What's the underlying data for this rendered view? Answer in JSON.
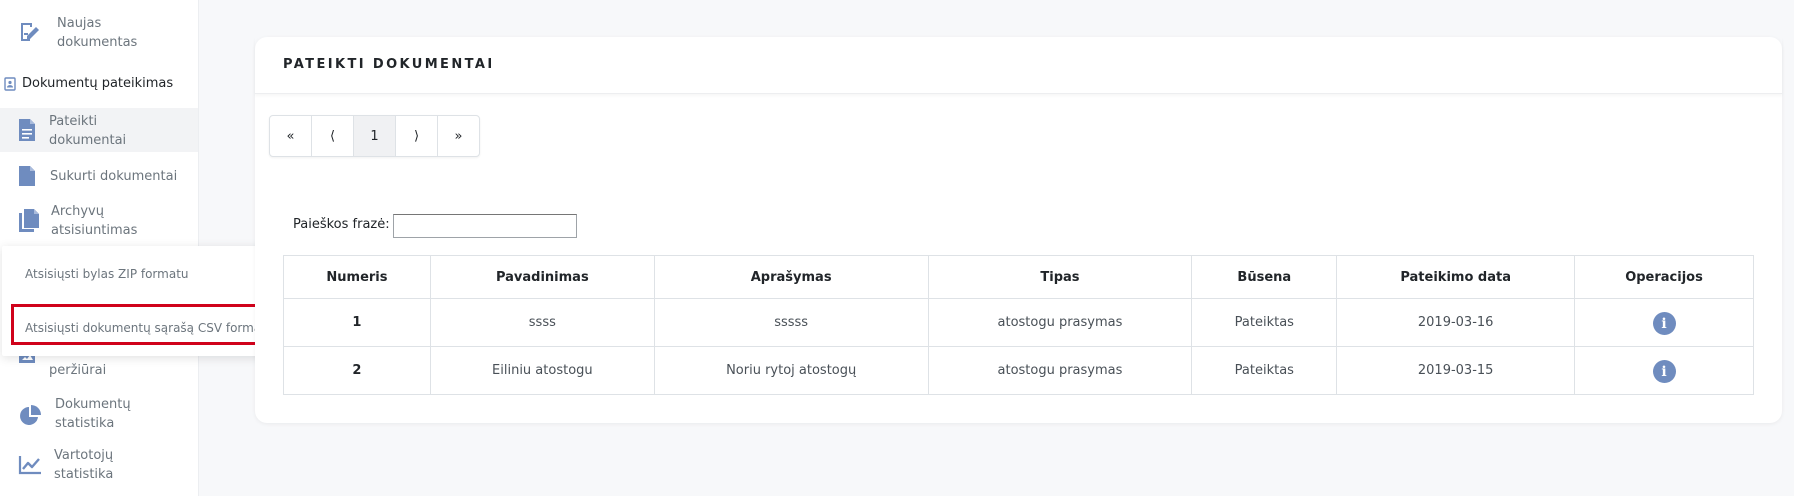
{
  "sidebar": {
    "items": [
      {
        "label": "Naujas dokumentas",
        "icon": "edit-document-icon"
      },
      {
        "label": "Dokumentų pateikimas",
        "icon": "contact-card-icon"
      },
      {
        "label": "Pateikti dokumentai",
        "icon": "document-icon"
      },
      {
        "label": "Sukurti dokumentai",
        "icon": "document-icon"
      },
      {
        "label": "Archyvų atsisiuntimas",
        "icon": "copy-documents-icon"
      },
      {
        "label": "peržiūrai",
        "icon": "image-document-icon"
      },
      {
        "label": "Dokumentų statistika",
        "icon": "pie-chart-icon"
      },
      {
        "label": "Vartotojų statistika",
        "icon": "line-chart-icon"
      }
    ]
  },
  "popup": {
    "zip": "Atsisiųsti bylas ZIP formatu",
    "csv": "Atsisiųsti dokumentų sąrašą CSV formatu"
  },
  "card": {
    "title": "PATEIKTI DOKUMENTAI"
  },
  "pager": {
    "first": "«",
    "prev": "⟨",
    "current": "1",
    "next": "⟩",
    "last": "»"
  },
  "search": {
    "label": "Paieškos frazė:",
    "value": ""
  },
  "table": {
    "headers": [
      "Numeris",
      "Pavadinimas",
      "Aprašymas",
      "Tipas",
      "Būsena",
      "Pateikimo data",
      "Operacijos"
    ],
    "rows": [
      {
        "numeris": "1",
        "pavadinimas": "ssss",
        "aprasymas": "sssss",
        "tipas": "atostogu prasymas",
        "busena": "Pateiktas",
        "data": "2019-03-16"
      },
      {
        "numeris": "2",
        "pavadinimas": "Eiliniu atostogu",
        "aprasymas": "Noriu rytoj atostogų",
        "tipas": "atostogu prasymas",
        "busena": "Pateiktas",
        "data": "2019-03-15"
      }
    ]
  },
  "colors": {
    "accent_icon": "#6f8cbf",
    "highlight_border": "#d0021b",
    "page_background": "#f7f8fa"
  }
}
